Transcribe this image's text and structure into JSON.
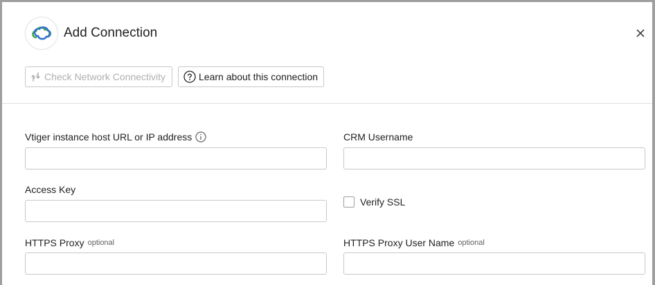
{
  "dialog": {
    "title": "Add Connection",
    "logo_icon": "vtiger-logo-icon",
    "close_icon": "close-icon"
  },
  "toolbar": {
    "check_label": "Check Network Connectivity",
    "check_icon": "network-check-icon",
    "learn_label": "Learn about this connection",
    "learn_icon": "help-circle-icon"
  },
  "fields": {
    "host_url": {
      "label": "Vtiger instance host URL or IP address",
      "value": "",
      "info_icon": "info-icon"
    },
    "crm_username": {
      "label": "CRM Username",
      "value": ""
    },
    "access_key": {
      "label": "Access Key",
      "value": ""
    },
    "verify_ssl": {
      "label": "Verify SSL",
      "checked": false
    },
    "https_proxy": {
      "label": "HTTPS Proxy",
      "optional": "optional",
      "value": ""
    },
    "proxy_user": {
      "label": "HTTPS Proxy User Name",
      "optional": "optional",
      "value": ""
    }
  },
  "colors": {
    "logo_blue": "#2f6fcf",
    "logo_green": "#3aa64a",
    "disabled_text": "#b0b0b0",
    "border": "#c8c8c8"
  }
}
